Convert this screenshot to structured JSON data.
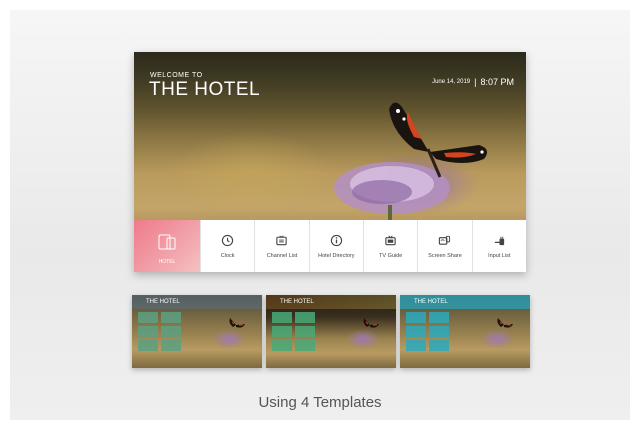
{
  "main_screen": {
    "welcome_text": "WELCOME TO",
    "hotel_name": "THE HOTEL",
    "date": "June 14, 2019",
    "separator": "|",
    "time": "8:07 PM"
  },
  "menu": {
    "home_label": "HOTEL",
    "items": [
      {
        "label": "Clock",
        "icon": "clock-icon"
      },
      {
        "label": "Channel List",
        "icon": "channel-list-icon"
      },
      {
        "label": "Hotel Directory",
        "icon": "info-icon"
      },
      {
        "label": "TV Guide",
        "icon": "tv-guide-icon"
      },
      {
        "label": "Screen Share",
        "icon": "screen-share-icon"
      },
      {
        "label": "Input List",
        "icon": "input-list-icon"
      }
    ]
  },
  "thumbnails": [
    {
      "title": "THE HOTEL"
    },
    {
      "title": "THE HOTEL"
    },
    {
      "title": "THE HOTEL"
    }
  ],
  "caption": "Using 4 Templates",
  "colors": {
    "home_tile": "#f07a8a",
    "menu_bar": "#ffffff",
    "template_teal": "#28a0b4"
  }
}
